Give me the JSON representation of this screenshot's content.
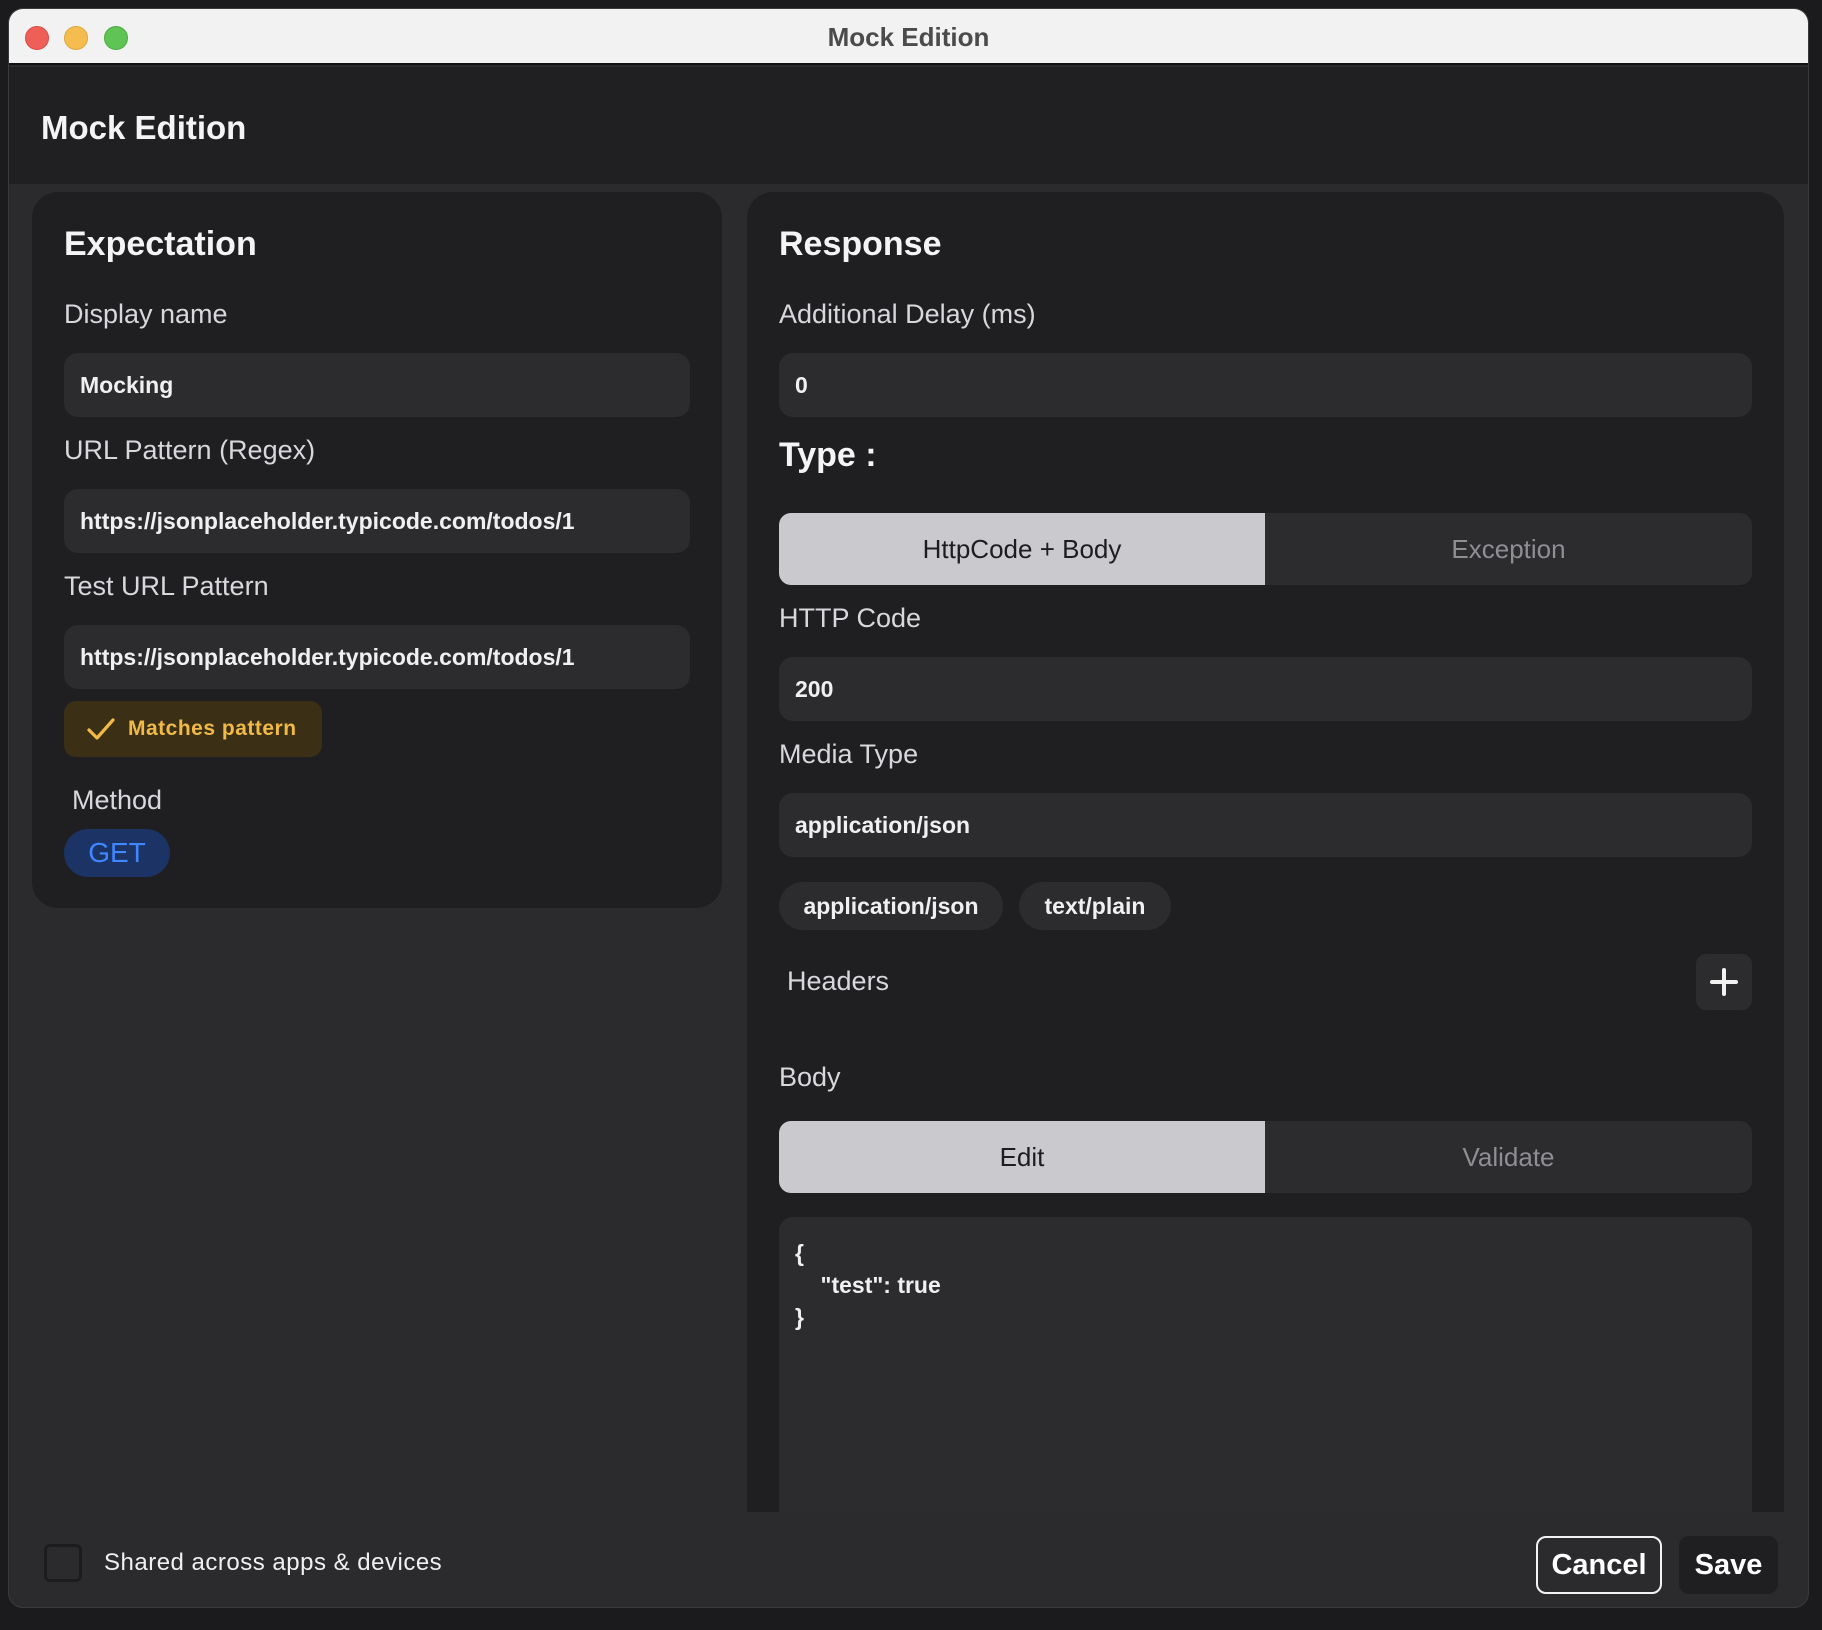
{
  "window": {
    "title": "Mock Edition"
  },
  "header": {
    "title": "Mock Edition"
  },
  "expectation": {
    "title": "Expectation",
    "display_name_label": "Display name",
    "display_name_value": "Mocking",
    "url_pattern_label": "URL Pattern (Regex)",
    "url_pattern_value": "https://jsonplaceholder.typicode.com/todos/1",
    "test_url_label": "Test URL Pattern",
    "test_url_value": "https://jsonplaceholder.typicode.com/todos/1",
    "match_badge": "Matches pattern",
    "method_label": "Method",
    "method_value": "GET"
  },
  "response": {
    "title": "Response",
    "delay_label": "Additional Delay (ms)",
    "delay_value": "0",
    "type_label": "Type :",
    "type_options": [
      "HttpCode + Body",
      "Exception"
    ],
    "type_selected": "HttpCode + Body",
    "http_code_label": "HTTP Code",
    "http_code_value": "200",
    "media_type_label": "Media Type",
    "media_type_value": "application/json",
    "media_suggestions": [
      "application/json",
      "text/plain"
    ],
    "headers_label": "Headers",
    "body_label": "Body",
    "body_tabs": [
      "Edit",
      "Validate"
    ],
    "body_tab_selected": "Edit",
    "body_content": "{\n    \"test\": true\n}"
  },
  "footer": {
    "shared_label": "Shared across apps & devices",
    "shared_checked": false,
    "cancel_label": "Cancel",
    "save_label": "Save"
  },
  "colors": {
    "accent_match": "#f1ba47",
    "method_blue": "#3f86ff",
    "background": "#2b2b2e"
  }
}
